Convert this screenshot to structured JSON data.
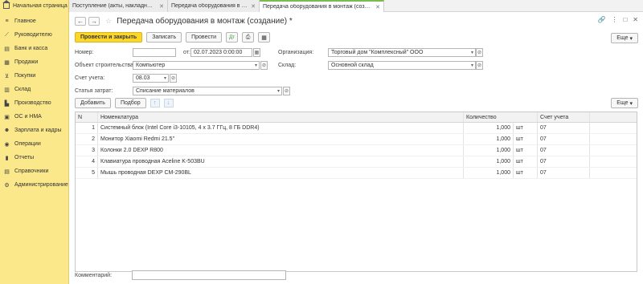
{
  "home": {
    "label": "Начальная страница"
  },
  "tabs": [
    {
      "label": "Поступление (акты, накладные, УПД)",
      "active": false
    },
    {
      "label": "Передача оборудования в монтаж",
      "active": false
    },
    {
      "label": "Передача оборудования в монтаж (создание) *",
      "active": true
    }
  ],
  "sidebar": {
    "items": [
      {
        "label": "Главное",
        "icon": "menu-icon"
      },
      {
        "label": "Руководителю",
        "icon": "chart-line-icon"
      },
      {
        "label": "Банк и касса",
        "icon": "bank-icon"
      },
      {
        "label": "Продажи",
        "icon": "sales-icon"
      },
      {
        "label": "Покупки",
        "icon": "cart-icon"
      },
      {
        "label": "Склад",
        "icon": "warehouse-icon"
      },
      {
        "label": "Производство",
        "icon": "factory-icon"
      },
      {
        "label": "ОС и НМА",
        "icon": "assets-icon"
      },
      {
        "label": "Зарплата и кадры",
        "icon": "people-icon"
      },
      {
        "label": "Операции",
        "icon": "operations-icon"
      },
      {
        "label": "Отчеты",
        "icon": "reports-icon"
      },
      {
        "label": "Справочники",
        "icon": "book-icon"
      },
      {
        "label": "Администрирование",
        "icon": "gear-icon"
      }
    ]
  },
  "header": {
    "title": "Передача оборудования в монтаж (создание) *"
  },
  "toolbar": {
    "post_close": "Провести и закрыть",
    "save": "Записать",
    "post": "Провести",
    "more": "Еще"
  },
  "form": {
    "number_label": "Номер:",
    "number_value": "",
    "date_label": "от:",
    "date_value": "02.07.2023  0:00:00",
    "org_label": "Организация:",
    "org_value": "Торговый дом \"Комплексный\" ООО",
    "site_label": "Объект строительства:",
    "site_value": "Компьютер",
    "warehouse_label": "Склад:",
    "warehouse_value": "Основной склад",
    "account_label": "Счет учета:",
    "account_value": "08.03",
    "cost_label": "Статья затрат:",
    "cost_value": "Списание материалов"
  },
  "table_toolbar": {
    "add": "Добавить",
    "pick": "Подбор",
    "more": "Еще"
  },
  "table": {
    "headers": {
      "n": "N",
      "nom": "Номенклатура",
      "qty": "Количество",
      "acc": "Счет учета"
    },
    "rows": [
      {
        "n": "1",
        "nom": "Системный блок (Intel Core i3-10105, 4 x 3.7 ГГц, 8 ГБ DDR4)",
        "qty": "1,000",
        "unit": "шт",
        "acc": "07"
      },
      {
        "n": "2",
        "nom": "Монитор Xiaomi Redmi 21.5\"",
        "qty": "1,000",
        "unit": "шт",
        "acc": "07"
      },
      {
        "n": "3",
        "nom": "Колонки 2.0 DEXP R800",
        "qty": "1,000",
        "unit": "шт",
        "acc": "07"
      },
      {
        "n": "4",
        "nom": "Клавиатура проводная Aceline K-503BU",
        "qty": "1,000",
        "unit": "шт",
        "acc": "07"
      },
      {
        "n": "5",
        "nom": "Мышь проводная DEXP CM-290BL",
        "qty": "1,000",
        "unit": "шт",
        "acc": "07"
      }
    ]
  },
  "comment": {
    "label": "Комментарий:",
    "value": ""
  }
}
